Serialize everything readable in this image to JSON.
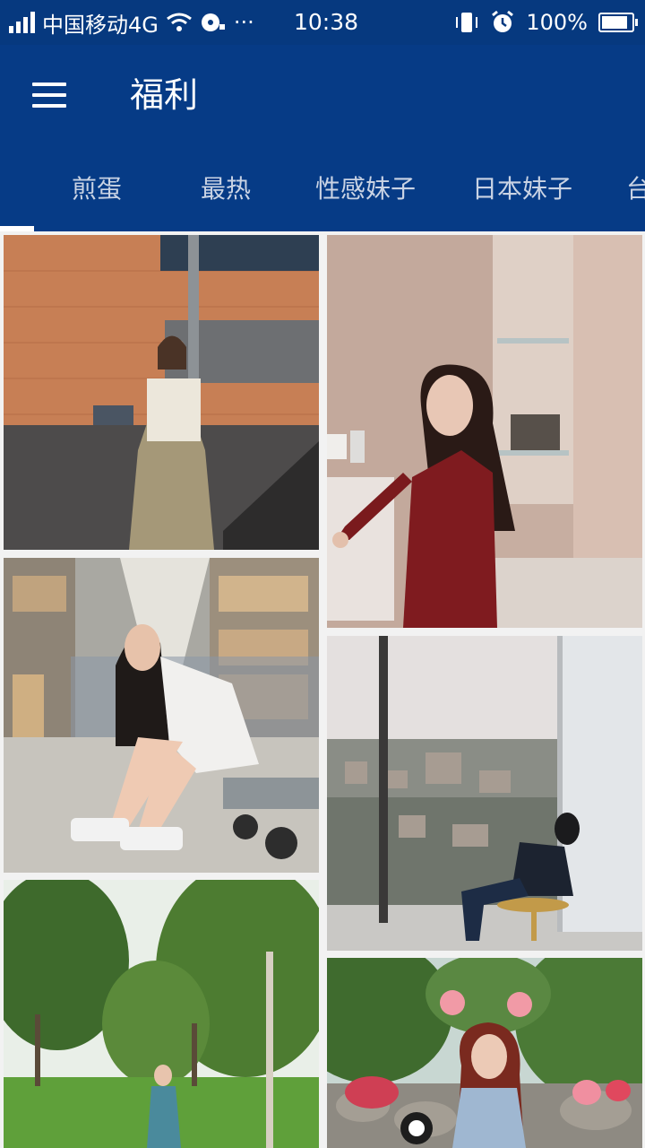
{
  "status_bar": {
    "carrier": "中国移动4G",
    "dots": "···",
    "time": "10:38",
    "battery": "100%",
    "battery_level": 1.0
  },
  "app_bar": {
    "title": "福利"
  },
  "tabs": [
    {
      "label": "煎蛋"
    },
    {
      "label": "最热"
    },
    {
      "label": "性感妹子"
    },
    {
      "label": "日本妹子"
    },
    {
      "label": "台"
    }
  ],
  "colors": {
    "primary": "#063b86",
    "status_bar": "#06397f",
    "tab_text": "#c9d3e4",
    "indicator": "#ffffff"
  },
  "photos": [
    {
      "name": "photo-woman-brick-wall"
    },
    {
      "name": "photo-woman-bathroom"
    },
    {
      "name": "photo-woman-warehouse"
    },
    {
      "name": "photo-woman-window-city"
    },
    {
      "name": "photo-woman-trees-lawn"
    },
    {
      "name": "photo-woman-palm-garden"
    }
  ]
}
